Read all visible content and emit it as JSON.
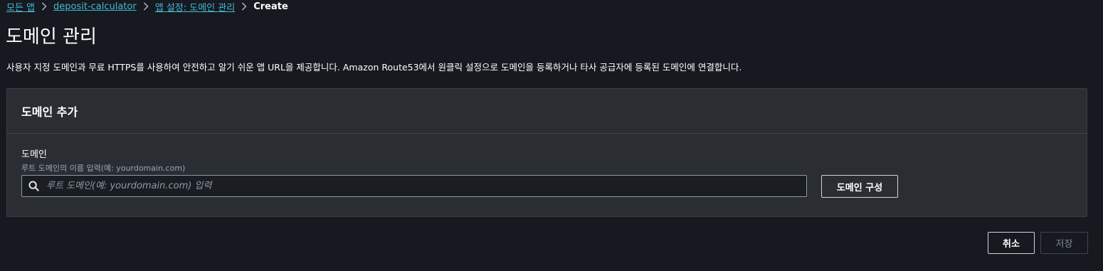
{
  "breadcrumb": {
    "items": [
      "모든 앱",
      "deposit-calculator",
      "앱 설정: 도메인 관리"
    ],
    "current": "Create"
  },
  "page": {
    "title": "도메인 관리",
    "description": "사용자 지정 도메인과 무료 HTTPS를 사용하여 안전하고 알기 쉬운 앱 URL을 제공합니다. Amazon Route53에서 원클릭 설정으로 도메인을 등록하거나 타사 공급자에 등록된 도메인에 연결합니다."
  },
  "panel": {
    "title": "도메인 추가",
    "field_label": "도메인",
    "field_hint": "루트 도메인의 이름 입력(예: yourdomain.com)",
    "input_value": "",
    "input_placeholder": "루트 도메인(예: yourdomain.com) 입력",
    "configure_label": "도메인 구성"
  },
  "footer": {
    "cancel_label": "취소",
    "save_label": "저장"
  },
  "icons": {
    "breadcrumb_separator": "chevron-right-icon",
    "search": "search-icon"
  },
  "colors": {
    "background": "#16191f",
    "link": "#44b9d6",
    "panel": "#2a2e33"
  }
}
